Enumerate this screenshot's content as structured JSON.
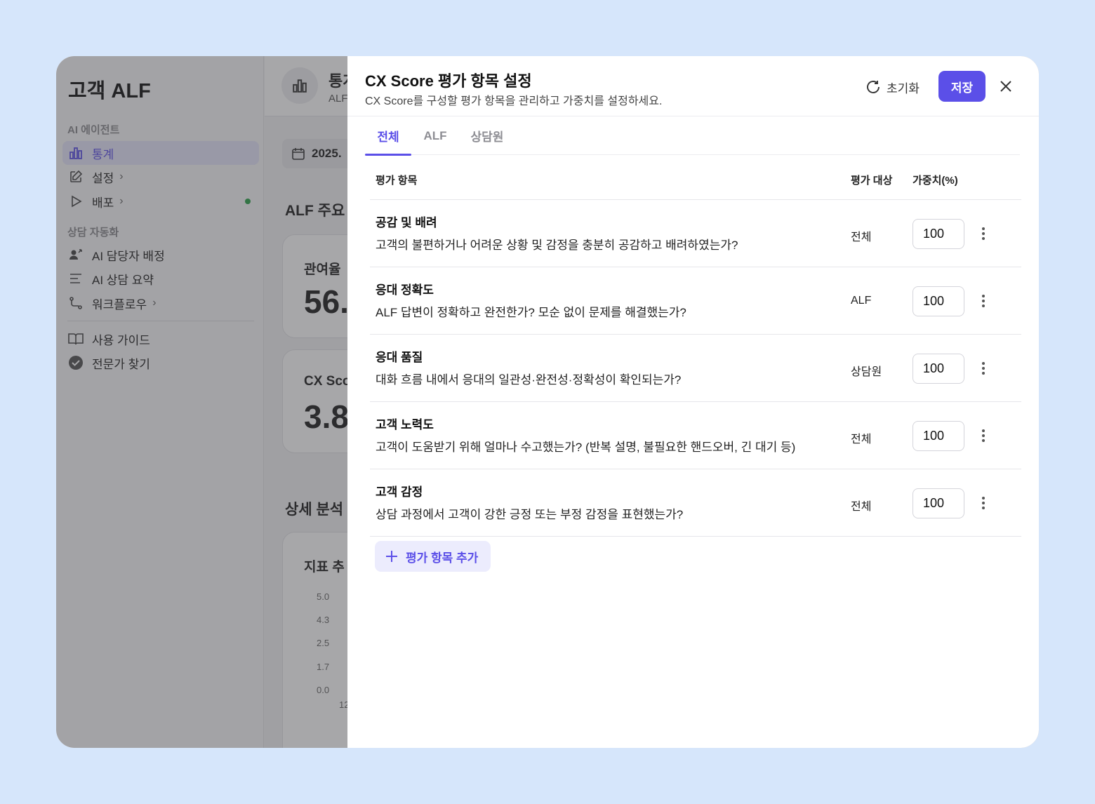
{
  "app": {
    "title": "고객 ALF",
    "sidebar": {
      "section_ai": "AI 에이전트",
      "items_ai": [
        {
          "label": "통계",
          "active": true
        },
        {
          "label": "설정",
          "chevron": "›"
        },
        {
          "label": "배포",
          "chevron": "›",
          "dot": true
        }
      ],
      "section_auto": "상담 자동화",
      "items_auto": [
        {
          "label": "AI 담당자 배정"
        },
        {
          "label": "AI 상담 요약"
        },
        {
          "label": "워크플로우",
          "chevron": "›"
        }
      ],
      "items_bottom": [
        {
          "label": "사용 가이드"
        },
        {
          "label": "전문가 찾기"
        }
      ]
    },
    "main": {
      "header_title": "통계",
      "header_sub": "ALF",
      "date": "2025.",
      "section1": "ALF 주요",
      "card1_label": "관여율",
      "card1_value": "56.",
      "card2_label": "CX Sco",
      "card2_value": "3.8",
      "section2": "상세 분석",
      "chart_title": "지표 추",
      "chart_ticks": [
        "5.0",
        "4.3",
        "2.5",
        "1.7",
        "0.0"
      ],
      "chart_xtick": "12"
    }
  },
  "drawer": {
    "title": "CX Score 평가 항목 설정",
    "subtitle": "CX Score를 구성할 평가 항목을 관리하고 가중치를 설정하세요.",
    "reset_label": "초기화",
    "save_label": "저장",
    "tabs": [
      "전체",
      "ALF",
      "상담원"
    ],
    "active_tab": 0,
    "columns": {
      "item": "평가 항목",
      "target": "평가 대상",
      "weight": "가중치(%)"
    },
    "rows": [
      {
        "title": "공감 및 배려",
        "desc": "고객의 불편하거나 어려운 상황 및 감정을 충분히 공감하고 배려하였는가?",
        "target": "전체",
        "weight": "100"
      },
      {
        "title": "응대 정확도",
        "desc": "ALF 답변이 정확하고 완전한가? 모순 없이 문제를 해결했는가?",
        "target": "ALF",
        "weight": "100"
      },
      {
        "title": "응대 품질",
        "desc": "대화 흐름 내에서 응대의 일관성·완전성·정확성이 확인되는가?",
        "target": "상담원",
        "weight": "100"
      },
      {
        "title": "고객 노력도",
        "desc": "고객이 도움받기 위해 얼마나 수고했는가? (반복 설명, 불필요한 핸드오버, 긴 대기 등)",
        "target": "전체",
        "weight": "100"
      },
      {
        "title": "고객 감정",
        "desc": "상담 과정에서 고객이 강한 긍정 또는 부정 감정을 표현했는가?",
        "target": "전체",
        "weight": "100"
      }
    ],
    "add_label": "평가 항목 추가"
  },
  "colors": {
    "accent": "#5b4fe8",
    "background": "#d6e6fb"
  }
}
